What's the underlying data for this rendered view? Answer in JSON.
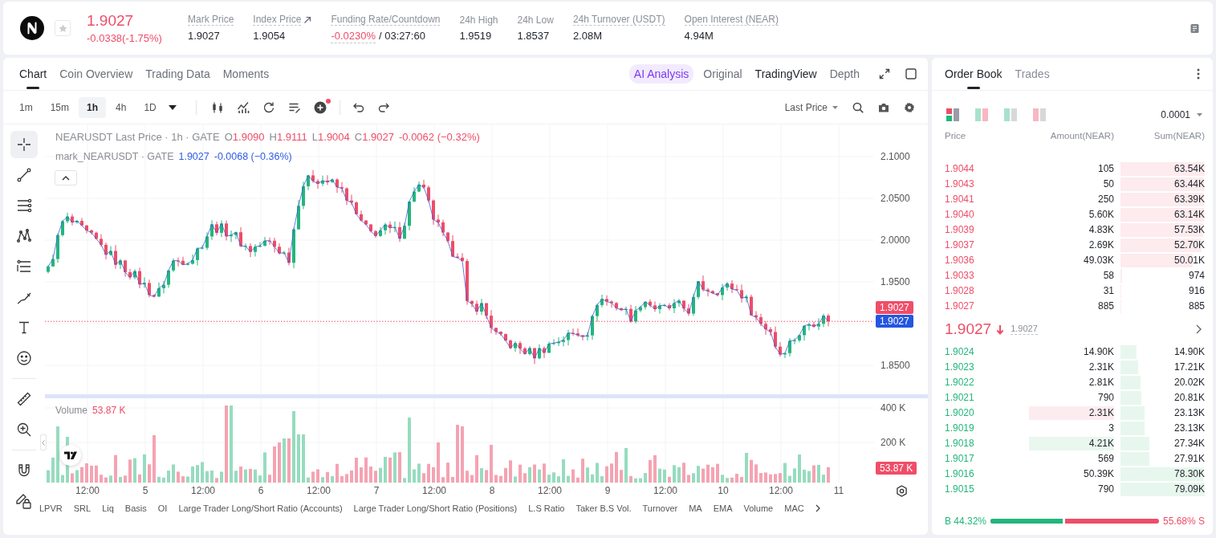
{
  "header": {
    "favorited": false,
    "falling": true,
    "last_price": "1.9027",
    "change": "-0.0338(-1.75%)",
    "stats": [
      {
        "kind": "plain",
        "label": "Mark Price",
        "value": "1.9027",
        "underlined": true
      },
      {
        "kind": "link",
        "label": "Index Price",
        "value": "1.9054",
        "underlined": true
      },
      {
        "kind": "funding",
        "label": "Funding Rate/Countdown",
        "value": "-0.0230%",
        "falling": true,
        "countdown": "/ 03:27:60",
        "underlined": true
      },
      {
        "kind": "plain",
        "label": "24h High",
        "value": "1.9519",
        "underlined": false
      },
      {
        "kind": "plain",
        "label": "24h Low",
        "value": "1.8537",
        "underlined": false
      },
      {
        "kind": "plain",
        "label": "24h Turnover (USDT)",
        "value": "2.08M",
        "underlined": true
      },
      {
        "kind": "plain",
        "label": "Open Interest (NEAR)",
        "value": "4.94M",
        "underlined": true
      }
    ]
  },
  "chart": {
    "tabs": [
      {
        "label": "Chart",
        "selected": true
      },
      {
        "label": "Coin Overview",
        "selected": false
      },
      {
        "label": "Trading Data",
        "selected": false
      },
      {
        "label": "Moments",
        "selected": false
      }
    ],
    "views": [
      {
        "label": "AI Analysis",
        "kind": "ai",
        "selected": false
      },
      {
        "label": "Original",
        "kind": "plain",
        "selected": false
      },
      {
        "label": "TradingView",
        "kind": "plain",
        "selected": true
      },
      {
        "label": "Depth",
        "kind": "plain",
        "selected": false
      }
    ],
    "intervals": [
      {
        "label": "1m",
        "selected": false
      },
      {
        "label": "15m",
        "selected": false
      },
      {
        "label": "1h",
        "selected": true
      },
      {
        "label": "4h",
        "selected": false
      },
      {
        "label": "1D",
        "selected": false
      }
    ],
    "alert_dot": true,
    "price_source": "Last Price",
    "drawing_tools": [
      {
        "kind": "crosshair",
        "selected": true
      },
      {
        "kind": "trend-line",
        "selected": false
      },
      {
        "kind": "parallel-lines",
        "selected": false
      },
      {
        "kind": "pattern",
        "selected": false
      },
      {
        "kind": "fib-levels",
        "selected": false
      },
      {
        "kind": "brush",
        "selected": false
      },
      {
        "kind": "text",
        "selected": false
      },
      {
        "kind": "emoji",
        "selected": false
      },
      {
        "kind": "ruler",
        "selected": false
      },
      {
        "kind": "zoom-in",
        "selected": false
      },
      {
        "kind": "magnet",
        "selected": false
      },
      {
        "kind": "lock-drawings",
        "selected": false
      }
    ],
    "legend": {
      "title": "NEARUSDT Last Price · 1h · GATE",
      "falling": true,
      "ohlc": [
        {
          "key": "O",
          "value": "1.9090"
        },
        {
          "key": "H",
          "value": "1.9111"
        },
        {
          "key": "L",
          "value": "1.9004"
        },
        {
          "key": "C",
          "value": "1.9027"
        }
      ],
      "change": "-0.0062 (−0.32%)",
      "mark_title": "mark_NEARUSDT · GATE",
      "mark_value": "1.9027",
      "mark_change": "-0.0068 (−0.36%)"
    },
    "price_axis": [
      "2.1000",
      "2.0500",
      "2.0000",
      "1.9500",
      "1.8500"
    ],
    "last_price_tag": "1.9027",
    "mark_price_tag": "1.9027",
    "volume": {
      "label": "Volume",
      "value": "53.87 K",
      "axis": [
        "400 K",
        "200 K"
      ],
      "tag": "53.87 K"
    },
    "time_axis": [
      "12:00",
      "5",
      "12:00",
      "6",
      "12:00",
      "7",
      "12:00",
      "8",
      "12:00",
      "9",
      "12:00",
      "10",
      "12:00",
      "11"
    ],
    "indicators": [
      "LPVR",
      "SRL",
      "Liq",
      "Basis",
      "OI",
      "Large Trader Long/Short Ratio (Accounts)",
      "Large Trader Long/Short Ratio (Positions)",
      "L.S Ratio",
      "Taker B.S Vol.",
      "Turnover",
      "MA",
      "EMA",
      "Volume",
      "MAC"
    ]
  },
  "order_book": {
    "tabs": [
      {
        "label": "Order Book",
        "selected": true
      },
      {
        "label": "Trades",
        "selected": false
      }
    ],
    "layouts": [
      {
        "kind": "all",
        "selected": true
      },
      {
        "kind": "side-by-side",
        "selected": false
      },
      {
        "kind": "bids",
        "selected": false
      },
      {
        "kind": "asks",
        "selected": false
      }
    ],
    "tick_size": "0.0001",
    "columns": [
      "Price",
      "Amount(NEAR)",
      "Sum(NEAR)"
    ],
    "asks": [
      {
        "price": "1.9044",
        "amount": "105",
        "sum": "63.54K",
        "level": 1.0
      },
      {
        "price": "1.9043",
        "amount": "50",
        "sum": "63.44K",
        "level": 0.99
      },
      {
        "price": "1.9041",
        "amount": "250",
        "sum": "63.39K",
        "level": 0.99
      },
      {
        "price": "1.9040",
        "amount": "5.60K",
        "sum": "63.14K",
        "level": 0.99
      },
      {
        "price": "1.9039",
        "amount": "4.83K",
        "sum": "57.53K",
        "level": 0.98
      },
      {
        "price": "1.9037",
        "amount": "2.69K",
        "sum": "52.70K",
        "level": 0.96
      },
      {
        "price": "1.9036",
        "amount": "49.03K",
        "sum": "50.01K",
        "level": 0.86
      },
      {
        "price": "1.9033",
        "amount": "58",
        "sum": "974",
        "level": 0.02
      },
      {
        "price": "1.9028",
        "amount": "31",
        "sum": "916",
        "level": 0.01
      },
      {
        "price": "1.9027",
        "amount": "885",
        "sum": "885",
        "level": 0.01
      }
    ],
    "mid": {
      "price": "1.9027",
      "falling": true,
      "mark": "1.9027"
    },
    "bids": [
      {
        "price": "1.9024",
        "amount": "14.90K",
        "sum": "14.90K",
        "level": 0.19
      },
      {
        "price": "1.9023",
        "amount": "2.31K",
        "sum": "17.21K",
        "level": 0.21
      },
      {
        "price": "1.9022",
        "amount": "2.81K",
        "sum": "20.02K",
        "level": 0.24
      },
      {
        "price": "1.9021",
        "amount": "790",
        "sum": "20.81K",
        "level": 0.25
      },
      {
        "price": "1.9020",
        "amount": "2.31K",
        "sum": "23.13K",
        "level": 0.29,
        "color": "#fdecef"
      },
      {
        "price": "1.9019",
        "amount": "3",
        "sum": "23.13K",
        "level": 0.29
      },
      {
        "price": "1.9018",
        "amount": "4.21K",
        "sum": "27.34K",
        "level": 0.34,
        "color": "#e9f7ef"
      },
      {
        "price": "1.9017",
        "amount": "569",
        "sum": "27.91K",
        "level": 0.34
      },
      {
        "price": "1.9016",
        "amount": "50.39K",
        "sum": "78.30K",
        "level": 0.98
      },
      {
        "price": "1.9015",
        "amount": "790",
        "sum": "79.09K",
        "level": 1.0
      }
    ],
    "ratio": {
      "buy": "B 44.32%",
      "sell": "55.68% S",
      "level": 0.4432
    }
  }
}
